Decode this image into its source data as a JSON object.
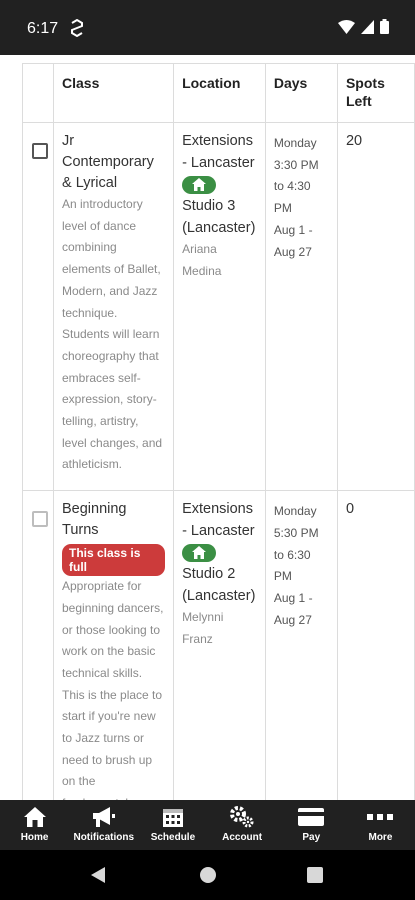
{
  "status_bar": {
    "time": "6:17"
  },
  "table": {
    "headers": {
      "class": "Class",
      "location": "Location",
      "days": "Days",
      "spots": "Spots Left"
    },
    "rows": [
      {
        "class_name": "Jr Contemporary & Lyrical",
        "full_badge": "",
        "description": "An introductory level of dance combining elements of Ballet, Modern, and Jazz technique. Students will learn choreography that embraces self-expression, story-telling, artistry, level changes, and athleticism.",
        "location_name": "Extensions - Lancaster",
        "studio": "Studio 3 (Lancaster)",
        "teacher": "Ariana Medina",
        "day": "Monday",
        "time": "3:30 PM to 4:30 PM",
        "dates": "Aug 1 - Aug 27",
        "spots": "20"
      },
      {
        "class_name": "Beginning Turns",
        "full_badge": "This class is full",
        "description": "Appropriate for beginning dancers, or those looking to work on the basic technical skills. This is the place to start if you're new to Jazz turns or need to brush up on the fundamentals.",
        "location_name": "Extensions - Lancaster",
        "studio": "Studio 2 (Lancaster)",
        "teacher": "Melynni Franz",
        "day": "Monday",
        "time": "5:30 PM to 6:30 PM",
        "dates": "Aug 1 - Aug 27",
        "spots": "0"
      }
    ]
  },
  "tab_bar": {
    "home": "Home",
    "notifications": "Notifications",
    "schedule": "Schedule",
    "account": "Account",
    "pay": "Pay",
    "more": "More"
  },
  "colors": {
    "full_badge": "#cc3b3b",
    "home_badge": "#3b8f44",
    "bar": "#212121"
  }
}
